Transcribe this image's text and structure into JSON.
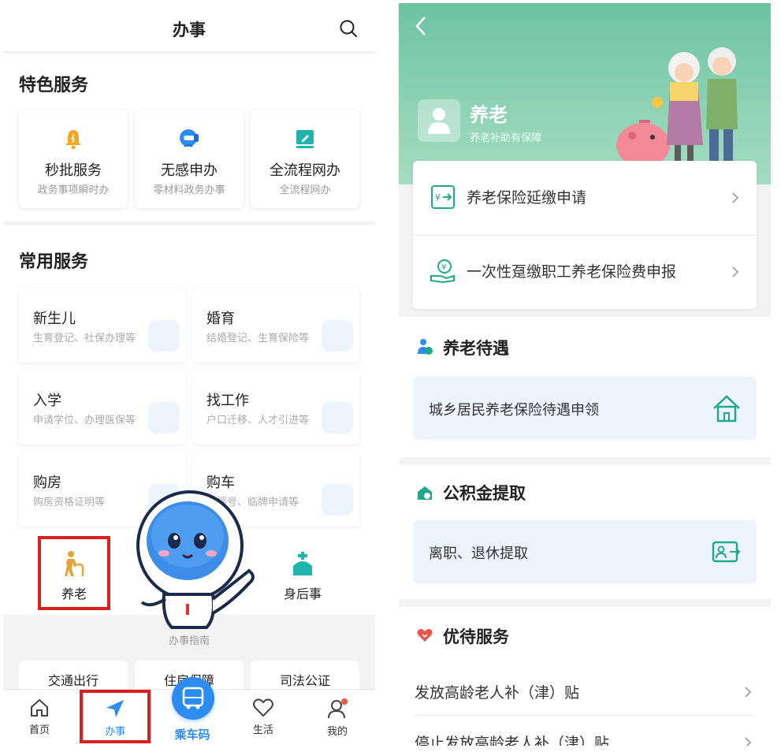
{
  "left": {
    "header": {
      "title": "办事"
    },
    "featured": {
      "title": "特色服务",
      "items": [
        {
          "name": "秒批服务",
          "desc": "政务事项瞬时办",
          "icon": "bell-icon"
        },
        {
          "name": "无感申办",
          "desc": "零材料政务办事",
          "icon": "face-scan-icon"
        },
        {
          "name": "全流程网办",
          "desc": "全流程网办",
          "icon": "edit-screen-icon"
        }
      ]
    },
    "common": {
      "title": "常用服务",
      "cards": [
        {
          "name": "新生儿",
          "desc": "生育登记、社保办理等"
        },
        {
          "name": "婚育",
          "desc": "结婚登记、生育保险等"
        },
        {
          "name": "入学",
          "desc": "申请学位、办理医保等"
        },
        {
          "name": "找工作",
          "desc": "户口迁移、人才引进等"
        },
        {
          "name": "购房",
          "desc": "购房资格证明等"
        },
        {
          "name": "购车",
          "desc": "车摇号、临牌申请等"
        }
      ],
      "grid": [
        {
          "label": "养老",
          "icon": "elderly-icon"
        },
        {
          "label": "身后事",
          "icon": "memorial-icon"
        }
      ]
    },
    "guide": {
      "title": "办事指南",
      "pills": [
        "交通出行",
        "住房保障",
        "司法公证"
      ]
    },
    "tabbar": {
      "tabs": [
        {
          "label": "首页",
          "icon": "home-icon"
        },
        {
          "label": "办事",
          "icon": "navigation-arrow-icon"
        },
        {
          "label": "乘车码",
          "icon": "bus-icon"
        },
        {
          "label": "生活",
          "icon": "heart-icon"
        },
        {
          "label": "我的",
          "icon": "profile-icon"
        }
      ],
      "active_color": "#2d8cf0"
    },
    "highlight_color": "#d9201e"
  },
  "right": {
    "banner": {
      "title": "养老",
      "subtitle": "养老补助有保障",
      "color": "#6cc3a2"
    },
    "top_rows": [
      {
        "label": "养老保险延缴申请",
        "icon": "currency-transfer-icon"
      },
      {
        "label": "一次性趸缴职工养老保险费申报",
        "icon": "hand-coin-icon"
      }
    ],
    "sections": [
      {
        "title": "养老待遇",
        "icon": "elder-person-icon",
        "card": "城乡居民养老保险待遇申领",
        "card_icon": "house-icon"
      },
      {
        "title": "公积金提取",
        "icon": "fund-house-icon",
        "card": "离职、退休提取",
        "card_icon": "id-card-icon"
      }
    ],
    "preferential": {
      "title": "优待服务",
      "icon": "heart-hands-icon",
      "rows": [
        "发放高龄老人补（津）贴",
        "停止发放高龄老人补（津）贴"
      ]
    }
  }
}
